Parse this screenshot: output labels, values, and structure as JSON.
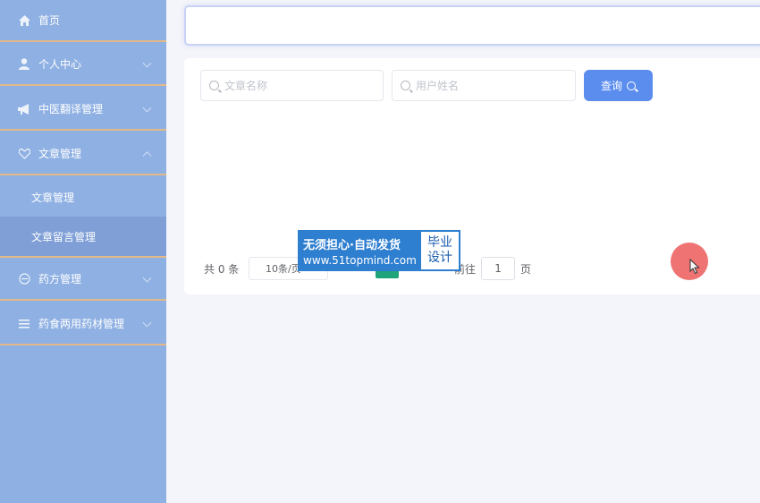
{
  "sidebar": {
    "items": [
      {
        "label": "首页",
        "icon": "home-icon"
      },
      {
        "label": "个人中心",
        "icon": "user-icon"
      },
      {
        "label": "中医翻译管理",
        "icon": "megaphone-icon"
      },
      {
        "label": "文章管理",
        "icon": "heart-icon"
      },
      {
        "label": "文章管理",
        "sub": true
      },
      {
        "label": "文章留言管理",
        "sub": true,
        "active": true
      },
      {
        "label": "药方管理",
        "icon": "pill-icon"
      },
      {
        "label": "药食两用药材管理",
        "icon": "list-icon"
      }
    ]
  },
  "search": {
    "article_placeholder": "文章名称",
    "user_placeholder": "用户姓名",
    "query_label": "查询"
  },
  "pagination": {
    "total_text": "共 0 条",
    "page_size": "10条/页",
    "goto_prefix": "前往",
    "goto_value": "1",
    "goto_suffix": "页"
  },
  "watermark": {
    "line1": "无须担心·自动发货",
    "line2": "www.51topmind.com",
    "badge1": "毕业",
    "badge2": "设计"
  },
  "colors": {
    "sidebar_bg": "#8fb0e3",
    "sidebar_divider": "#e3b98a",
    "primary_button": "#5b8def",
    "page_active": "#1fa37a"
  }
}
